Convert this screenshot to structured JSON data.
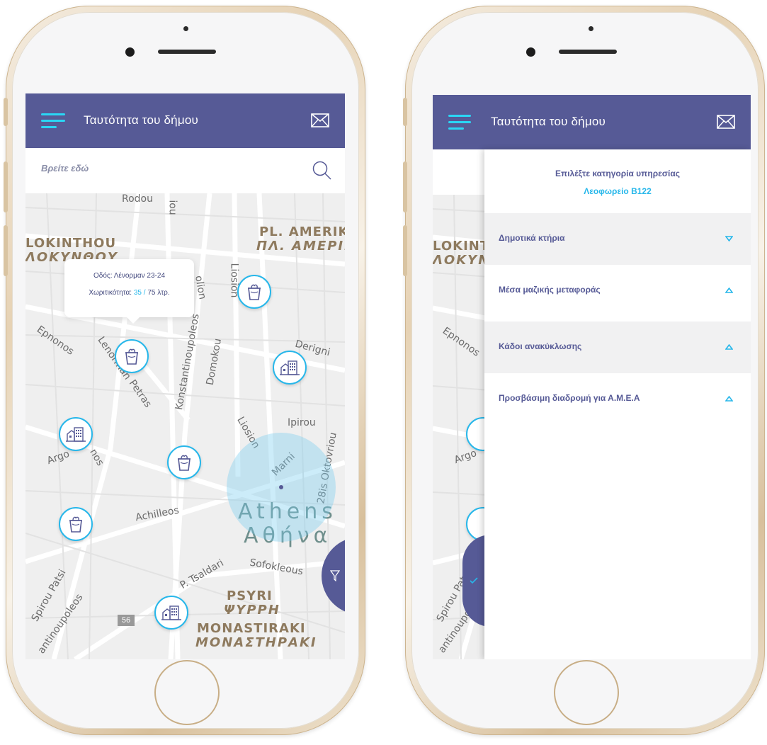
{
  "app": {
    "title": "Ταυτότητα του δήμου",
    "menu_icon": "hamburger-menu-icon",
    "mail_icon": "envelope-icon",
    "accent_color": "#27b7ea",
    "bar_color": "#565a96",
    "menu_color": "#2ad6f5"
  },
  "search": {
    "placeholder": "Βρείτε εδώ",
    "icon": "search-icon"
  },
  "callout": {
    "street_label": "Οδός: Λένορμαν 23-24",
    "capacity_label": "Χωριτικότητα:",
    "capacity_current": "35",
    "capacity_sep": " / ",
    "capacity_total": "75 λτρ."
  },
  "map": {
    "streets": [
      "Rodou",
      "Liosion",
      "Domokou",
      "Konstantinoupoleos",
      "Lenorman",
      "Petras",
      "Derigni",
      "Ipirou",
      "Liosion",
      "Marni",
      "28is Oktovriou",
      "Achilleos",
      "P. Tsaldari",
      "Sofokleous",
      "Spirou Patsi",
      "antinoupoleos",
      "Argo",
      "nos",
      "Epnonos",
      "olion",
      "iou",
      "D"
    ],
    "area_labels": [
      "LOKINTHOU",
      "ΛΟΚΥΝΘΟΥ",
      "PL. AMERIK",
      "ΠΛ. ΑΜΕΡΙΚ",
      "PSYRI",
      "ΨΥΡΡΗ",
      "MONASTIRAKI",
      "ΜΟΝΑΣΤΗΡΑΚΙ"
    ],
    "city_en": "Athens",
    "city_gr": "Αθήνα",
    "road_badge": "56"
  },
  "drawer": {
    "title": "Επιλέξτε κατηγορία υπηρεσίας",
    "subtitle": "Λεοφωρείο Β122",
    "categories": [
      {
        "label": "Δημοτικά κτήρια",
        "state": "expanded"
      },
      {
        "label": "Μέσα μαζικής μεταφοράς",
        "state": "collapsed"
      },
      {
        "label": "Κάδοι ανακύκλωσης",
        "state": "collapsed"
      },
      {
        "label": "Προσβάσιμη διαδρομή για Α.Μ.Ε.Α",
        "state": "collapsed"
      }
    ]
  },
  "left_map_labels_visible": {
    "lokin": "LOKINT",
    "lokin_gr": "ΛΟΚΥΝ",
    "argo": "Argo",
    "spirou": "Spirou Pats",
    "antino": "antinoupoleo",
    "epnonos": "Epnonos"
  }
}
